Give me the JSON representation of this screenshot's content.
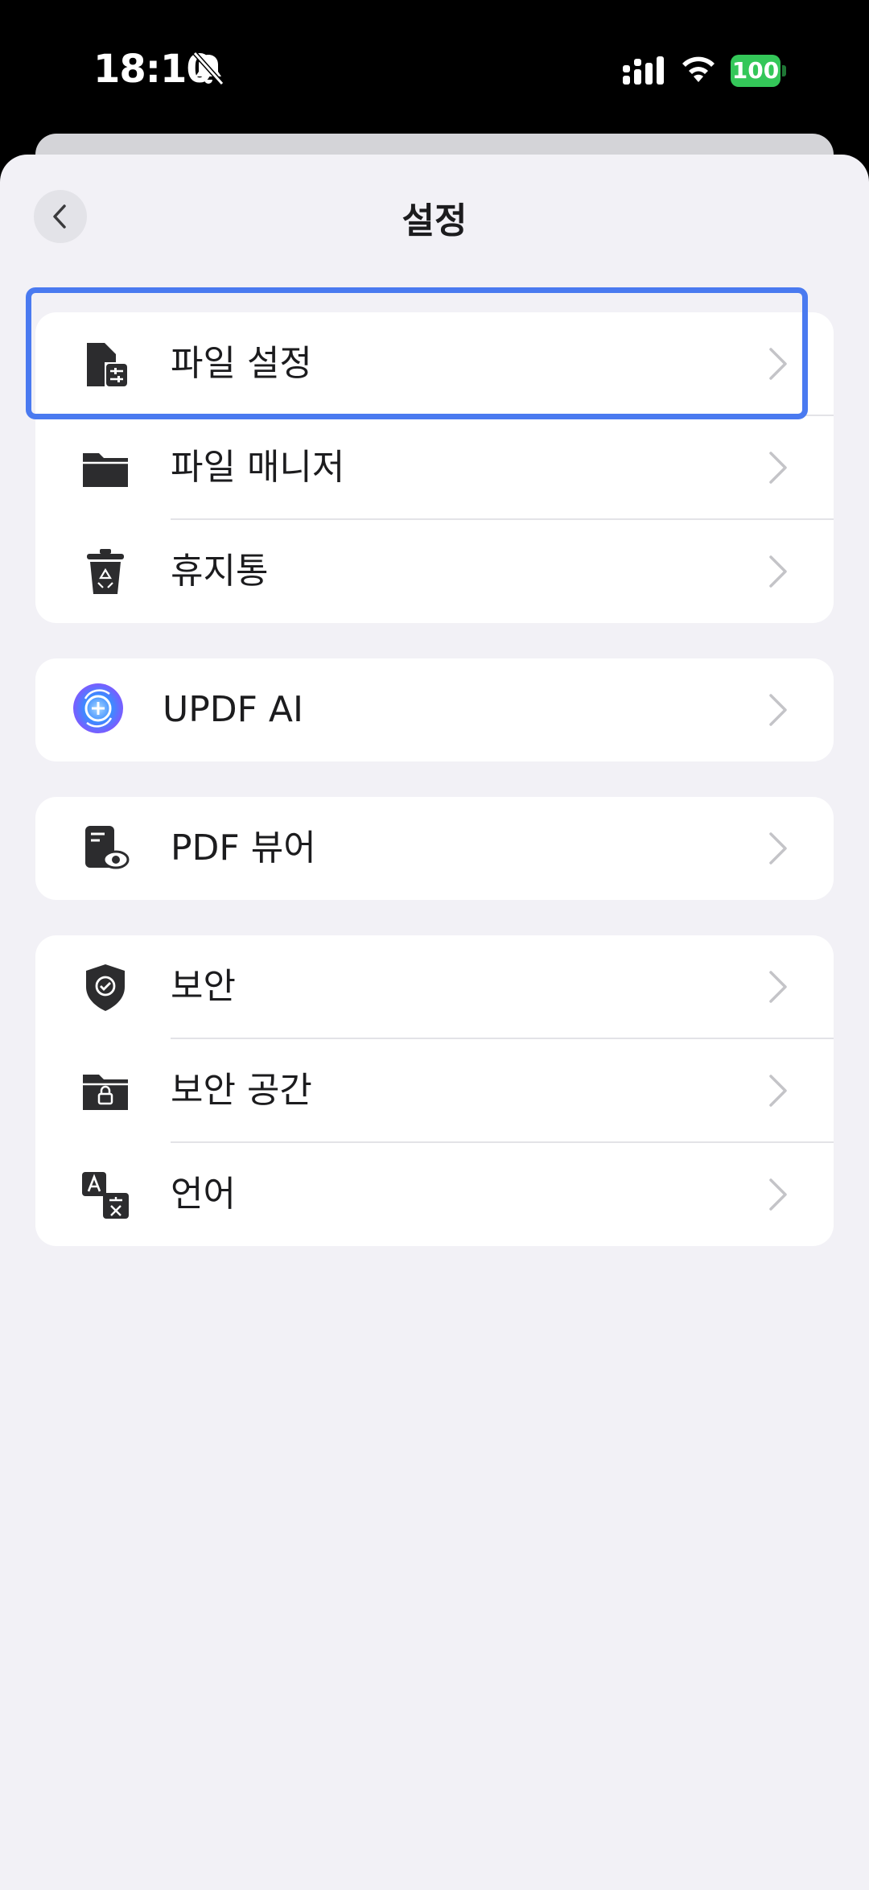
{
  "status_bar": {
    "time": "18:10",
    "battery": "100"
  },
  "header": {
    "title": "설정"
  },
  "groups": [
    {
      "items": [
        {
          "label": "파일 설정",
          "icon": "file-settings-icon"
        },
        {
          "label": "파일 매니저",
          "icon": "folder-icon"
        },
        {
          "label": "휴지통",
          "icon": "trash-icon"
        }
      ]
    },
    {
      "items": [
        {
          "label": "UPDF AI",
          "icon": "updf-ai-icon"
        }
      ]
    },
    {
      "items": [
        {
          "label": "PDF 뷰어",
          "icon": "pdf-viewer-icon"
        }
      ]
    },
    {
      "items": [
        {
          "label": "보안",
          "icon": "shield-icon"
        },
        {
          "label": "보안 공간",
          "icon": "secure-folder-icon"
        },
        {
          "label": "언어",
          "icon": "language-icon"
        }
      ]
    }
  ],
  "colors": {
    "highlight": "#4a7af0",
    "battery": "#34c759",
    "background": "#f2f1f6"
  }
}
